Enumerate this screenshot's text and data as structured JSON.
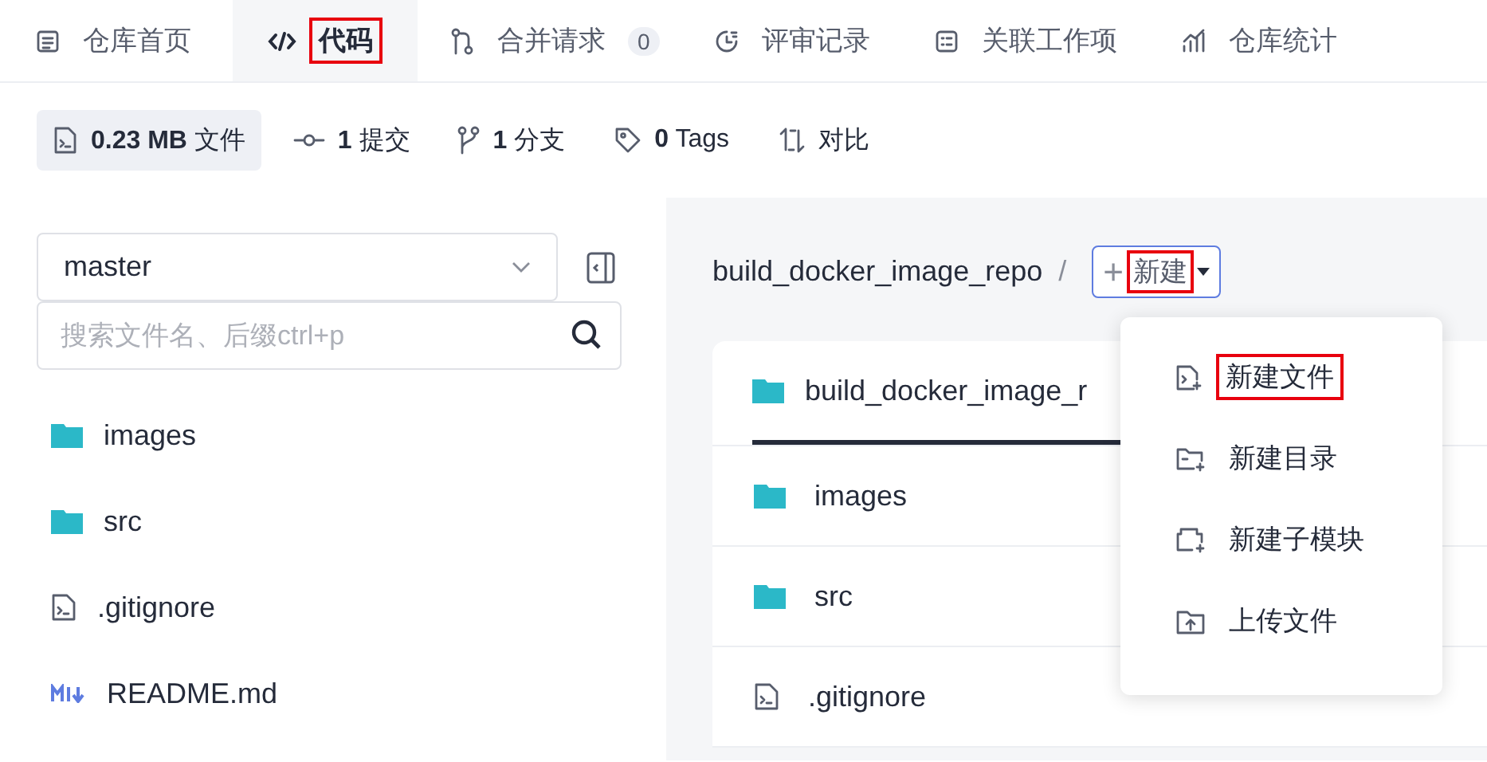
{
  "tabs": [
    {
      "label": "仓库首页",
      "selected": false,
      "highlighted": false
    },
    {
      "label": "代码",
      "selected": true,
      "highlighted": true
    },
    {
      "label": "合并请求",
      "badge": "0",
      "selected": false,
      "highlighted": false
    },
    {
      "label": "评审记录",
      "selected": false,
      "highlighted": false
    },
    {
      "label": "关联工作项",
      "selected": false,
      "highlighted": false
    },
    {
      "label": "仓库统计",
      "selected": false,
      "highlighted": false
    }
  ],
  "stats": [
    {
      "value": "0.23 MB",
      "label": "文件",
      "selected": true
    },
    {
      "value": "1",
      "label": "提交",
      "selected": false
    },
    {
      "value": "1",
      "label": "分支",
      "selected": false
    },
    {
      "value": "0",
      "label": "Tags",
      "selected": false
    },
    {
      "label": "对比",
      "selected": false
    }
  ],
  "sidebar": {
    "branch": "master",
    "search": {
      "placeholder": "搜索文件名、后缀ctrl+p"
    },
    "items": [
      {
        "name": "images",
        "kind": "folder"
      },
      {
        "name": "src",
        "kind": "folder"
      },
      {
        "name": ".gitignore",
        "kind": "file"
      },
      {
        "name": "README.md",
        "kind": "markdown"
      }
    ]
  },
  "main": {
    "breadcrumb": "build_docker_image_repo",
    "separator": "/",
    "new_button": {
      "plus": "+",
      "label": "新建",
      "highlighted": true
    },
    "card_title": "build_docker_image_r",
    "rows": [
      {
        "name": "images",
        "kind": "folder"
      },
      {
        "name": "src",
        "kind": "folder"
      },
      {
        "name": ".gitignore",
        "kind": "file"
      }
    ],
    "menu": [
      {
        "label": "新建文件",
        "highlighted": true
      },
      {
        "label": "新建目录",
        "highlighted": false
      },
      {
        "label": "新建子模块",
        "highlighted": false
      },
      {
        "label": "上传文件",
        "highlighted": false
      }
    ]
  }
}
